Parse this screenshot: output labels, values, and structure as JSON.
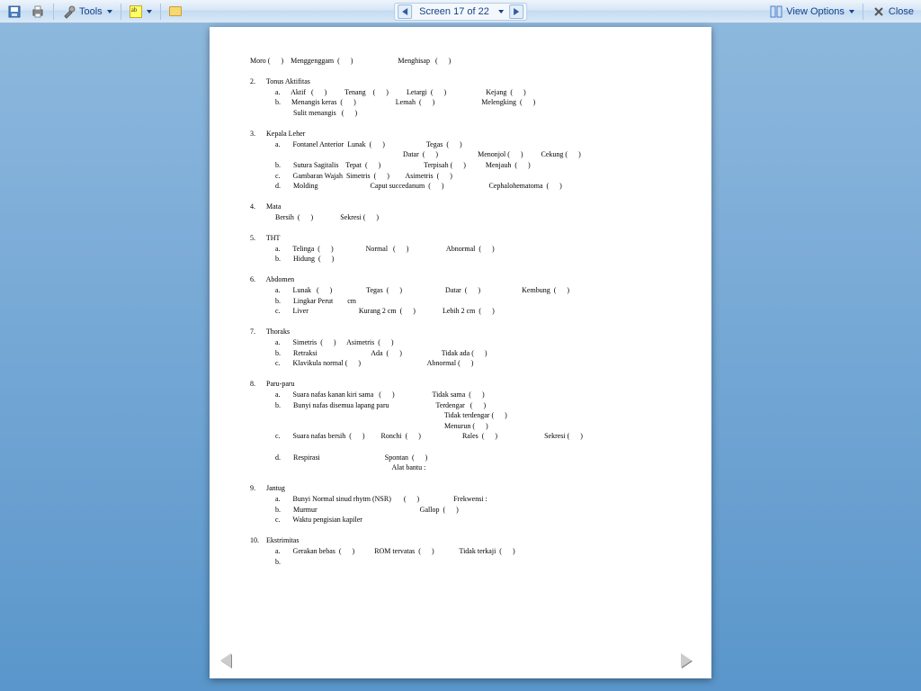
{
  "toolbar": {
    "tools_label": "Tools",
    "screen_label": "Screen 17 of 22",
    "view_options_label": "View Options",
    "close_label": "Close"
  },
  "doc": {
    "l1": "Moro (      )    Menggenggam  (      )                         Menghisap   (      )",
    "s2_num": "2.",
    "s2_title": "Tonus Aktifitas",
    "s2a": "a.      Aktif   (      )          Tenang    (      )          Letargi  (      )                      Kejang  (      )",
    "s2b": "b.      Menangis keras  (      )                      Lemah  (      )                          Melengking  (      )",
    "s2c": "          Sulit menangis   (      )",
    "s3_num": "3.",
    "s3_title": "Kepala Leher",
    "s3a": "a.       Fontanel Anterior  Lunak  (      )                       Tegas  (      )",
    "s3a2": "                                                                       Datar  (      )                      Menonjol (      )          Cekung (      )",
    "s3b": "b.       Sutura Sagitalis    Tepat  (      )                        Terpisah (      )           Menjauh  (      )",
    "s3c": "c.       Gambaran Wajah  Simetris  (      )         Asimetris  (      )",
    "s3d": "d.       Molding                             Caput succedanum  (      )                         Cephalohematoma  (      )",
    "s4_num": "4.",
    "s4_title": "Mata",
    "s4a": "Bersih  (      )               Sekresi (      )",
    "s5_num": "5.",
    "s5_title": "THT",
    "s5a": "a.       Telinga  (      )                  Normal   (      )                     Abnormal  (      )",
    "s5b": "b.       Hidung  (      )",
    "s6_num": "6.",
    "s6_title": "Abdomen",
    "s6a": "a.       Lunak   (      )                   Tegas  (      )                        Datar  (      )                       Kembung  (      )",
    "s6b": "b.       Lingkar Perut        cm",
    "s6c": "c.       Liver                            Kurang 2 cm  (      )               Lebih 2 cm  (      )",
    "s7_num": "7.",
    "s7_title": "Thoraks",
    "s7a": "a.       Simetris  (      )      Asimetris  (      )",
    "s7b": "b.       Retraksi                              Ada  (      )                      Tidak ada (      )",
    "s7c": "c.       Klavikula normal (      )                                     Abnormal (      )",
    "s8_num": "8.",
    "s8_title": "Paru-paru",
    "s8a": "a.       Suara nafas kanan kiri sama   (      )                     Tidak sama  (      )",
    "s8b": "b.       Bunyi nafas disemua lapang paru                          Terdengar   (      )",
    "s8b2": "                                                                                              Tidak terdengar (      )",
    "s8b3": "                                                                                              Menurun (      )",
    "s8c": "c.       Suara nafas bersih  (      )         Ronchi  (      )                       Rales  (      )                          Sekresi (      )",
    "s8d": "d.       Respirasi                                    Spontan  (      )",
    "s8d2": "                                                                 Alat bantu :",
    "s9_num": "9.",
    "s9_title": "Jantug",
    "s9a": "a.       Bunyi Normal sinud rhytm (NSR)       (      )                   Frekwensi :",
    "s9b": "b.       Murmur                                                         Gallop  (      )",
    "s9c": "c.       Waktu pengisian kapiler",
    "s10_num": "10.",
    "s10_title": "Ekstrimitas",
    "s10a": "a.       Gerakan bebas  (      )           ROM tervatas  (      )              Tidak terkaji  (      )",
    "s10b": "b."
  }
}
